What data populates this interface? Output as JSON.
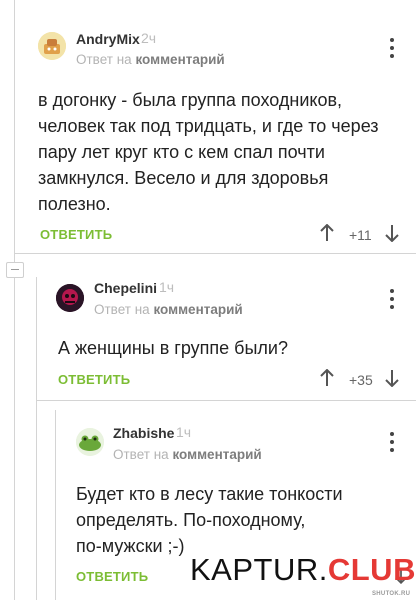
{
  "comments": [
    {
      "username": "AndryMix",
      "time": "2ч",
      "reply_prefix": "Ответ на",
      "reply_target": "комментарий",
      "text_lines": [
        "в догонку - была группа походников,",
        "человек так под тридцать, и где то через",
        "пару лет круг кто с кем спал почти",
        "замкнулся. Весело и для здоровья",
        "полезно."
      ],
      "action": "ОТВЕТИТЬ",
      "rating": "+11"
    },
    {
      "username": "Chepelini",
      "time": "1ч",
      "reply_prefix": "Ответ на",
      "reply_target": "комментарий",
      "text_lines": [
        "А женщины в группе были?"
      ],
      "action": "ОТВЕТИТЬ",
      "rating": "+35"
    },
    {
      "username": "Zhabishe",
      "time": "1ч",
      "reply_prefix": "Ответ на",
      "reply_target": "комментарий",
      "text_lines": [
        "Будет кто в лесу такие тонкости",
        "определять. По-походному,",
        "по-мужски ;-)"
      ],
      "action": "ОТВЕТИТЬ",
      "rating": ""
    }
  ],
  "watermark": {
    "part1": "KAPTUR.",
    "part2": "CLUB",
    "small": "SHUTOK.RU"
  },
  "colors": {
    "accent_green": "#7cbd34",
    "muted": "#b3b3b3",
    "watermark_red": "#e53935"
  }
}
